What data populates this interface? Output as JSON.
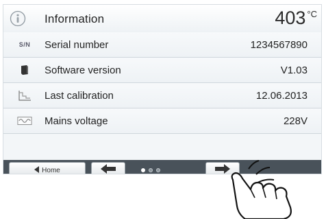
{
  "header": {
    "icon": "info-icon",
    "title": "Information",
    "temperature": "403",
    "unit": "°C"
  },
  "rows": [
    {
      "icon": "sn-icon",
      "icon_text": "S/N",
      "label": "Serial number",
      "value": "1234567890"
    },
    {
      "icon": "chip-icon",
      "label": "Software version",
      "value": "V1.03"
    },
    {
      "icon": "calibration-curve-icon",
      "label": "Last calibration",
      "value": "12.06.2013"
    },
    {
      "icon": "voltage-wave-icon",
      "label": "Mains voltage",
      "value": "228V"
    }
  ],
  "nav": {
    "home_label": "Home",
    "page_indicator": {
      "count": 3,
      "active_index": 0
    }
  },
  "colors": {
    "bottom_bar": "#49525a",
    "screen_bg": "#f3f6f8"
  }
}
